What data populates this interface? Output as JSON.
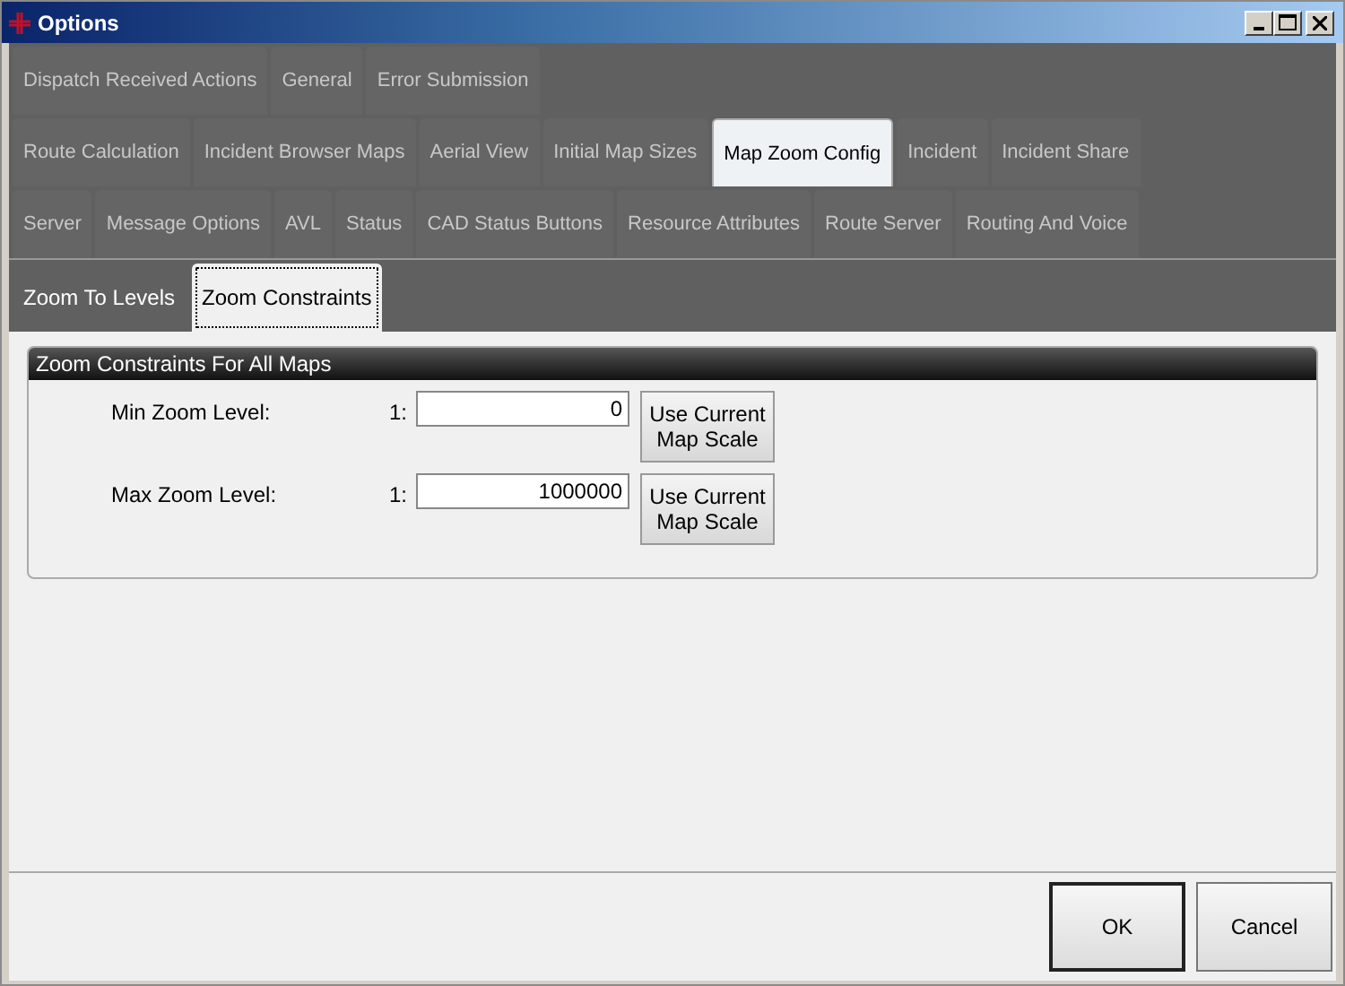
{
  "window": {
    "title": "Options"
  },
  "tab_rows": [
    [
      {
        "label": "Dispatch Received Actions",
        "selected": false
      },
      {
        "label": "General",
        "selected": false
      },
      {
        "label": "Error Submission",
        "selected": false
      }
    ],
    [
      {
        "label": "Route Calculation",
        "selected": false
      },
      {
        "label": "Incident Browser Maps",
        "selected": false
      },
      {
        "label": "Aerial View",
        "selected": false
      },
      {
        "label": "Initial Map Sizes",
        "selected": false
      },
      {
        "label": "Map Zoom Config",
        "selected": true
      },
      {
        "label": "Incident",
        "selected": false
      },
      {
        "label": "Incident Share",
        "selected": false
      }
    ],
    [
      {
        "label": "Server",
        "selected": false
      },
      {
        "label": "Message Options",
        "selected": false
      },
      {
        "label": "AVL",
        "selected": false
      },
      {
        "label": "Status",
        "selected": false
      },
      {
        "label": "CAD Status Buttons",
        "selected": false
      },
      {
        "label": "Resource Attributes",
        "selected": false
      },
      {
        "label": "Route Server",
        "selected": false
      },
      {
        "label": "Routing And Voice",
        "selected": false
      }
    ]
  ],
  "sub_tabs": [
    {
      "label": "Zoom To Levels",
      "selected": false
    },
    {
      "label": "Zoom Constraints",
      "selected": true
    }
  ],
  "group": {
    "title": "Zoom Constraints For All Maps",
    "fields": [
      {
        "label": "Min Zoom Level:",
        "prefix": "1:",
        "value": "0",
        "button": "Use Current Map Scale"
      },
      {
        "label": "Max Zoom Level:",
        "prefix": "1:",
        "value": "1000000",
        "button": "Use Current Map Scale"
      }
    ]
  },
  "buttons": [
    "OK",
    "Cancel"
  ]
}
